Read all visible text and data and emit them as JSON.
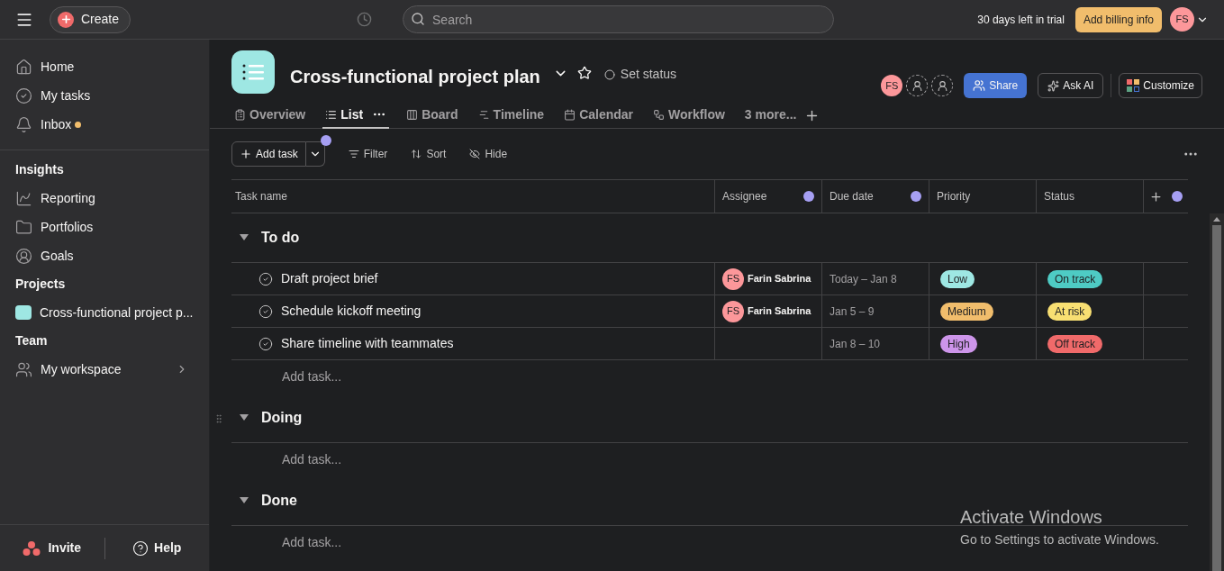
{
  "topbar": {
    "create_label": "Create",
    "search_placeholder": "Search",
    "trial_text": "30 days left in trial",
    "billing_button": "Add billing info",
    "avatar_initials": "FS"
  },
  "sidebar": {
    "nav": [
      {
        "label": "Home",
        "notification": false
      },
      {
        "label": "My tasks",
        "notification": false
      },
      {
        "label": "Inbox",
        "notification": true
      }
    ],
    "sections": [
      {
        "title": "Insights",
        "items": [
          {
            "label": "Reporting"
          },
          {
            "label": "Portfolios"
          },
          {
            "label": "Goals"
          }
        ]
      },
      {
        "title": "Projects",
        "items": [
          {
            "label": "Cross-functional project p...",
            "color": "#9ee7e3"
          }
        ]
      },
      {
        "title": "Team",
        "items": [
          {
            "label": "My workspace"
          }
        ]
      }
    ],
    "footer": {
      "invite": "Invite",
      "help": "Help"
    }
  },
  "project": {
    "title": "Cross-functional project plan",
    "set_status": "Set status",
    "members": [
      {
        "kind": "avatar",
        "initials": "FS"
      },
      {
        "kind": "empty"
      },
      {
        "kind": "empty"
      }
    ],
    "share": "Share",
    "ask_ai": "Ask AI",
    "customize": "Customize"
  },
  "tabs": [
    {
      "label": "Overview",
      "selected": false
    },
    {
      "label": "List",
      "selected": true
    },
    {
      "label": "Board",
      "selected": false
    },
    {
      "label": "Timeline",
      "selected": false
    },
    {
      "label": "Calendar",
      "selected": false
    },
    {
      "label": "Workflow",
      "selected": false
    },
    {
      "label": "3 more...",
      "selected": false
    }
  ],
  "toolbar": {
    "add_task": "Add task",
    "filter": "Filter",
    "sort": "Sort",
    "hide": "Hide"
  },
  "table": {
    "columns": [
      {
        "label": "Task name",
        "dot": false
      },
      {
        "label": "Assignee",
        "dot": true
      },
      {
        "label": "Due date",
        "dot": true
      },
      {
        "label": "Priority",
        "dot": false
      },
      {
        "label": "Status",
        "dot": false
      }
    ],
    "sections": [
      {
        "title": "To do",
        "expanded": true,
        "add_task": "Add task...",
        "tasks": [
          {
            "name": "Draft project brief",
            "assignee": {
              "initials": "FS",
              "name": "Farin Sabrina"
            },
            "due": "Today – Jan 8",
            "priority": {
              "label": "Low",
              "color": "#9ee7e3"
            },
            "status": {
              "label": "On track",
              "color": "#4ecbc4"
            }
          },
          {
            "name": "Schedule kickoff meeting",
            "assignee": {
              "initials": "FS",
              "name": "Farin Sabrina"
            },
            "due": "Jan 5 – 9",
            "priority": {
              "label": "Medium",
              "color": "#f1bd6c"
            },
            "status": {
              "label": "At risk",
              "color": "#f8df72"
            }
          },
          {
            "name": "Share timeline with teammates",
            "due": "Jan 8 – 10",
            "priority": {
              "label": "High",
              "color": "#cd95ea"
            },
            "status": {
              "label": "Off track",
              "color": "#f06a6a"
            }
          }
        ]
      },
      {
        "title": "Doing",
        "expanded": true,
        "add_task": "Add task..."
      },
      {
        "title": "Done",
        "expanded": true,
        "add_task": "Add task..."
      }
    ]
  },
  "windows_notice": {
    "title": "Activate Windows",
    "text": "Go to Settings to activate Windows."
  }
}
